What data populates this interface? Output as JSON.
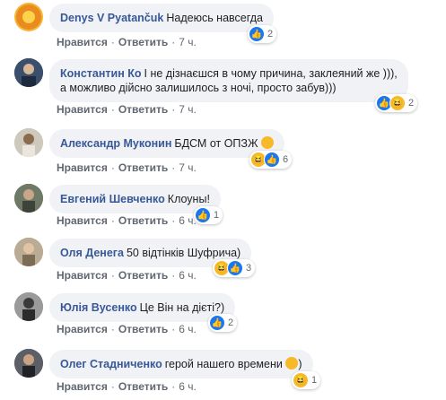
{
  "actions": {
    "like": "Нравится",
    "reply": "Ответить",
    "sep": "·"
  },
  "comments": [
    {
      "author": "Denys V Pyatančuk",
      "text": "Надеюсь навсегда",
      "time": "7 ч.",
      "count": "2"
    },
    {
      "author": "Константин Ко",
      "text": "І не дізнаєшся в чому причина, заклеяний же ))),",
      "text2": "а можливо дійсно залишилось з ночі, просто забув)))",
      "time": "7 ч.",
      "count": "2"
    },
    {
      "author": "Александр Муконин",
      "text": "БДСМ от ОПЗЖ",
      "time": "7 ч.",
      "count": "6"
    },
    {
      "author": "Евгений Шевченко",
      "text": "Клоуны!",
      "time": "6 ч.",
      "count": "1"
    },
    {
      "author": "Оля Денега",
      "text": "50 відтінків Шуфрича)",
      "time": "6 ч.",
      "count": "3"
    },
    {
      "author": "Юлія Вусенко",
      "text": "Це Він на дієті?)",
      "time": "6 ч.",
      "count": "2"
    },
    {
      "author": "Олег Стадниченко",
      "text": "герой нашего времени",
      "time": "6 ч.",
      "count": "1"
    }
  ],
  "colors": {
    "author": "#385898",
    "bubble": "#f0f2f5",
    "like": "#1877f2",
    "haha": "#f7b928"
  }
}
